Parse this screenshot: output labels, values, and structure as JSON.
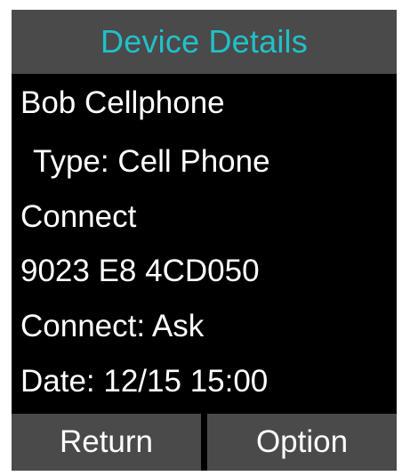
{
  "header": {
    "title": "Device Details"
  },
  "details": {
    "name": "Bob Cellphone",
    "type": "Type: Cell Phone",
    "status": "Connect",
    "address": "9023 E8 4CD050",
    "connect_mode": "Connect: Ask",
    "date": "Date: 12/15 15:00"
  },
  "softkeys": {
    "left_label": "Return",
    "right_label": "Option"
  },
  "colors": {
    "title_accent": "#22c0c8",
    "bar_background": "#4a4a4a",
    "screen_background": "#000000",
    "text": "#ffffff"
  }
}
